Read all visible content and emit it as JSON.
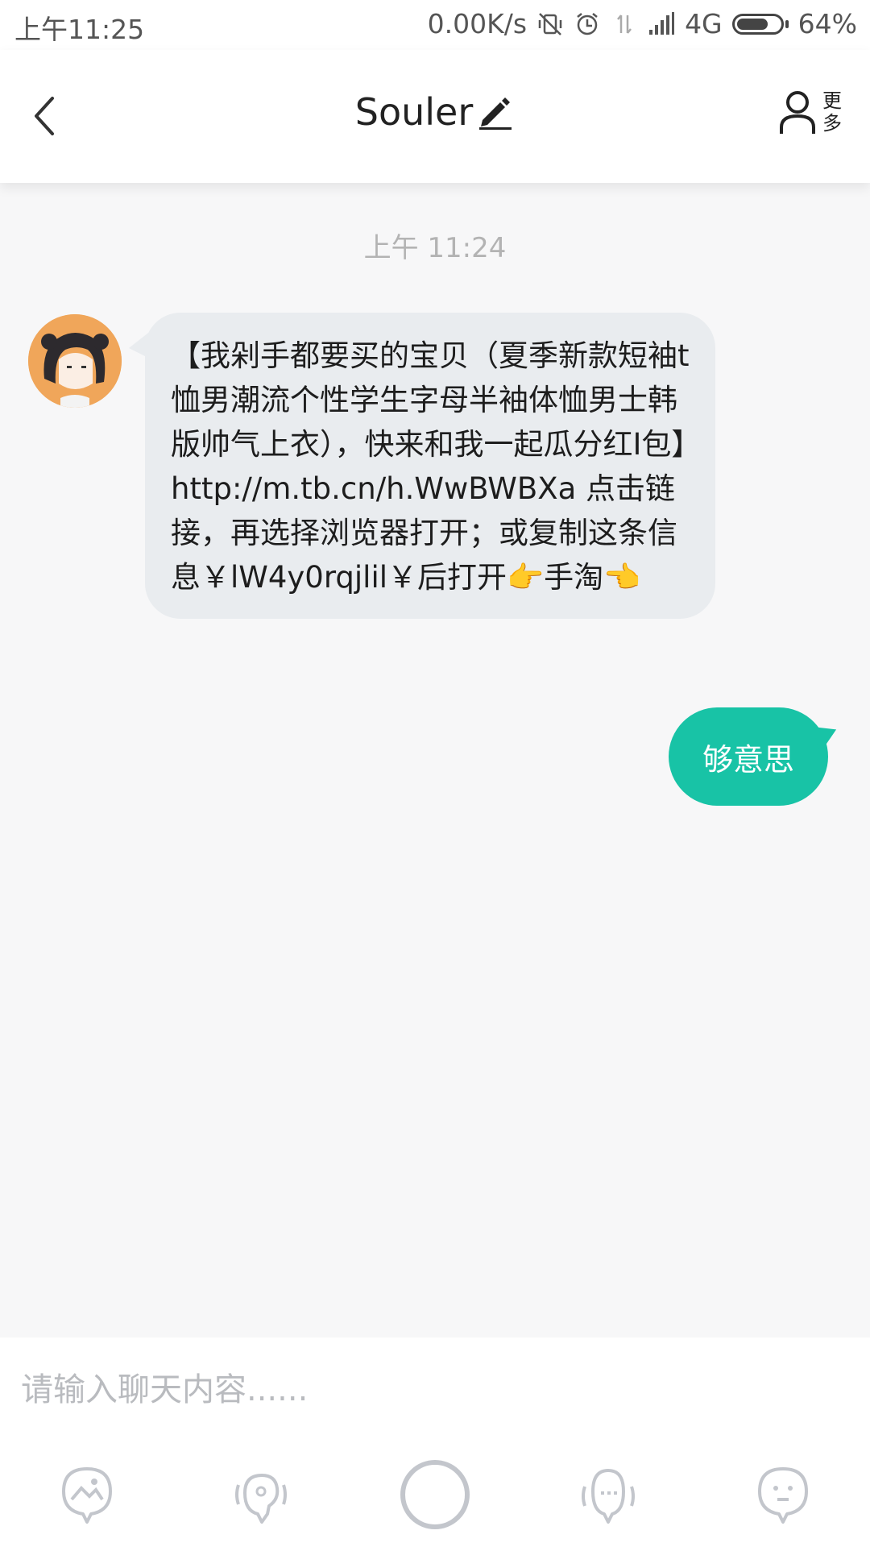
{
  "status_bar": {
    "time": "上午11:25",
    "network_speed": "0.00K/s",
    "network_type": "4G",
    "battery": "64%",
    "icons": [
      "vibrate-off-icon",
      "alarm-icon",
      "data-transfer-icon",
      "signal-icon",
      "battery-icon"
    ]
  },
  "header": {
    "title": "Souler",
    "more_label_line1": "更",
    "more_label_line2": "多",
    "icons": [
      "back-chevron-icon",
      "edit-pencil-icon",
      "person-icon"
    ]
  },
  "chat": {
    "timestamp": "上午 11:24",
    "messages": [
      {
        "side": "left",
        "text": "【我剁手都要买的宝贝（夏季新款短袖t恤男潮流个性学生字母半袖体恤男士韩版帅气上衣），快来和我一起瓜分红I包】http://m.tb.cn/h.WwBWBXa 点击链接，再选择浏览器打开；或复制这条信息￥lW4y0rqjlil￥后打开👉手淘👈"
      },
      {
        "side": "right",
        "text": "够意思"
      }
    ]
  },
  "input": {
    "placeholder": "请输入聊天内容......"
  },
  "toolbar": {
    "icons": [
      "image-icon",
      "voice-icon",
      "record-circle-icon",
      "mic-face-icon",
      "emoji-face-icon"
    ]
  },
  "colors": {
    "accent": "#18c3a6",
    "bubble_left": "#e9ecef",
    "background": "#f7f7f8"
  }
}
